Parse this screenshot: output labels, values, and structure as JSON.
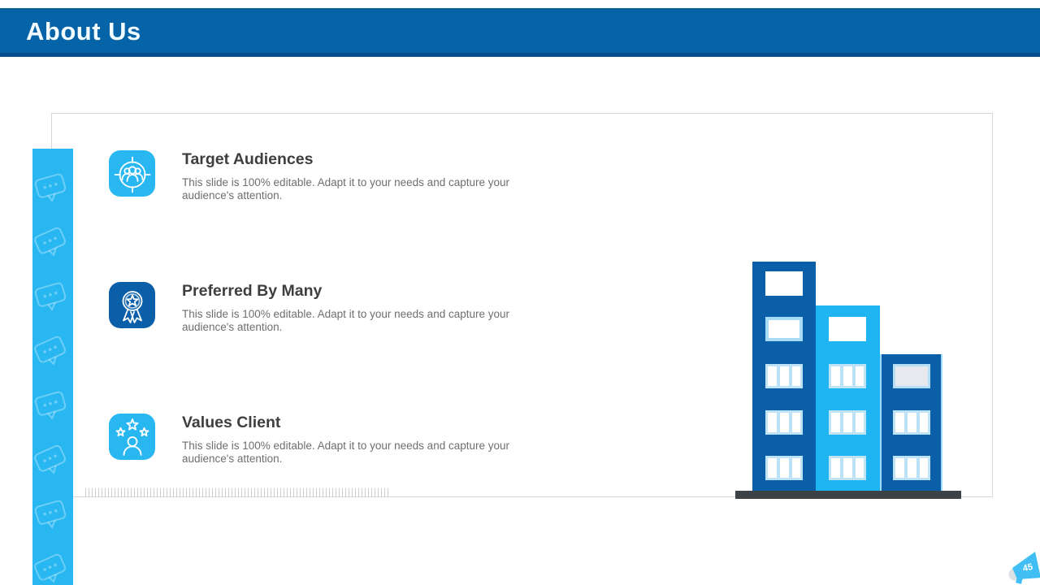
{
  "header": {
    "title": "About Us"
  },
  "items": [
    {
      "title": "Target Audiences",
      "description": "This slide is 100% editable. Adapt it to your needs and capture your audience's attention.",
      "icon": "target-audience-icon",
      "icon_bg": "#29b7f2"
    },
    {
      "title": "Preferred By Many",
      "description": "This slide is 100% editable. Adapt it to your needs and capture your audience's attention.",
      "icon": "award-ribbon-icon",
      "icon_bg": "#0b5fa9"
    },
    {
      "title": "Values Client",
      "description": "This slide is 100% editable. Adapt it to your needs and capture your audience's attention.",
      "icon": "person-stars-icon",
      "icon_bg": "#29b7f2"
    }
  ],
  "footer": {
    "slide_number": "45"
  },
  "illustration": {
    "name": "city-buildings",
    "building_colors": [
      "#0b5fa9",
      "#1fb4f2",
      "#0b5fa9"
    ],
    "ground_color": "#3d4247"
  },
  "colors": {
    "header_bar": "#0563a8",
    "accent_light": "#29b7f2",
    "accent_dark": "#0b5fa9",
    "title_text": "#3e3e3e",
    "body_text": "#6e6e6e"
  }
}
